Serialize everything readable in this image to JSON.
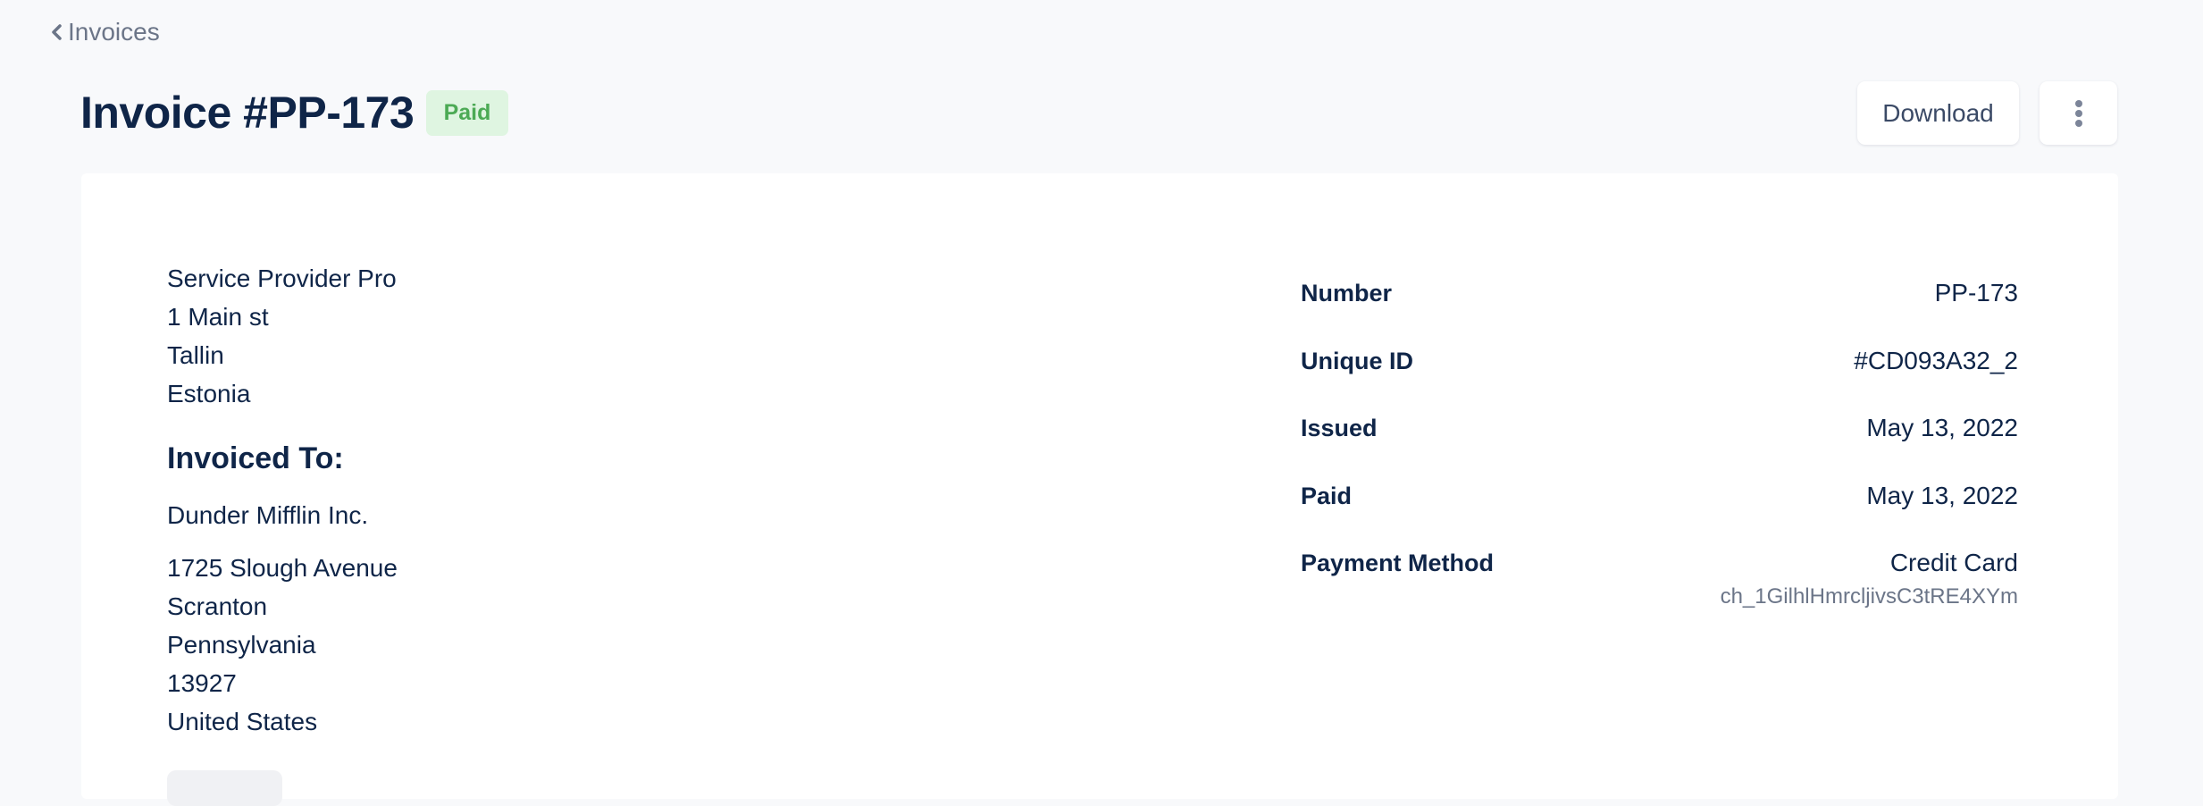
{
  "nav": {
    "back_label": "Invoices"
  },
  "header": {
    "title": "Invoice #PP-173",
    "status": "Paid",
    "download_label": "Download",
    "more_icon": "more-vertical-icon"
  },
  "colors": {
    "primary_text": "#0f2548",
    "muted_text": "#6b7588",
    "status_paid_bg": "#dff5e1",
    "status_paid_text": "#4caa55",
    "page_bg": "#f8f9fb"
  },
  "from": {
    "lines": [
      "Service Provider Pro",
      "1 Main st",
      "Tallin",
      "Estonia"
    ]
  },
  "to": {
    "heading": "Invoiced To:",
    "name": "Dunder Mifflin Inc.",
    "address": [
      "1725 Slough Avenue",
      "Scranton",
      "Pennsylvania",
      "13927",
      "United States"
    ]
  },
  "details": [
    {
      "label": "Number",
      "value": "PP-173"
    },
    {
      "label": "Unique ID",
      "value": "#CD093A32_2"
    },
    {
      "label": "Issued",
      "value": "May 13, 2022"
    },
    {
      "label": "Paid",
      "value": "May 13, 2022"
    },
    {
      "label": "Payment Method",
      "value": "Credit Card",
      "sub": "ch_1GilhlHmrcljivsC3tRE4XYm"
    }
  ]
}
